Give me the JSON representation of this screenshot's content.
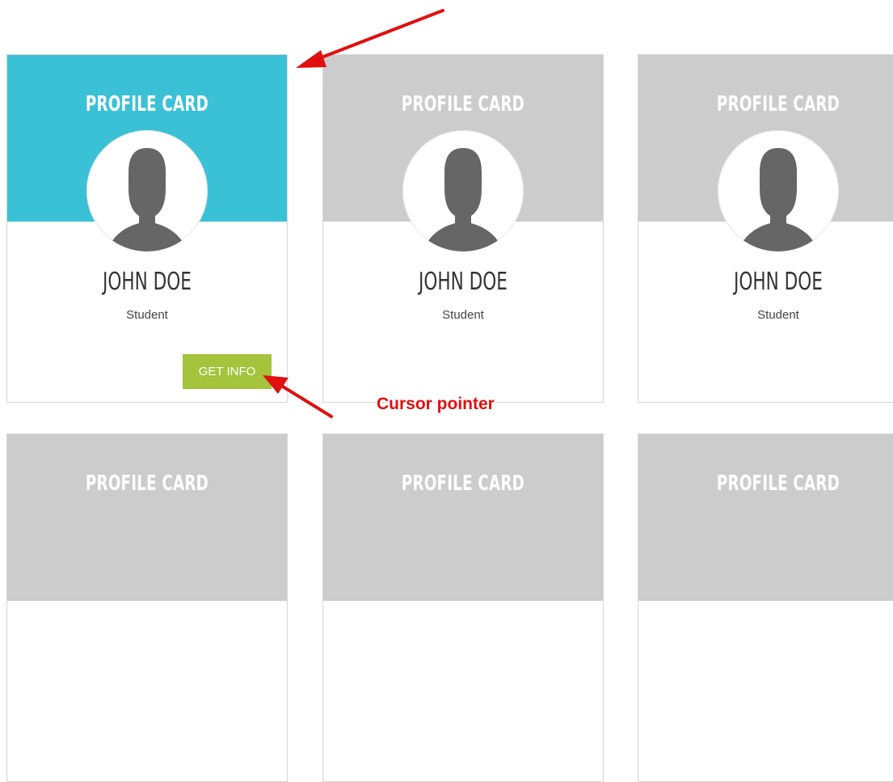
{
  "cards": [
    {
      "title": "PROFILE CARD",
      "name": "JOHN DOE",
      "role": "Student",
      "button": "GET INFO",
      "active": true
    },
    {
      "title": "PROFILE CARD",
      "name": "JOHN DOE",
      "role": "Student"
    },
    {
      "title": "PROFILE CARD",
      "name": "JOHN DOE",
      "role": "Student"
    },
    {
      "title": "PROFILE CARD"
    },
    {
      "title": "PROFILE CARD"
    },
    {
      "title": "PROFILE CARD"
    }
  ],
  "annotation": {
    "label": "Cursor pointer",
    "color": "#e01010"
  },
  "colors": {
    "active_header": "#3bc1d6",
    "inactive_header": "#cccccc",
    "button": "#a3c43b",
    "avatar_silhouette": "#666666"
  },
  "icons": [
    "user-silhouette-icon",
    "arrow-annotation-icon"
  ]
}
